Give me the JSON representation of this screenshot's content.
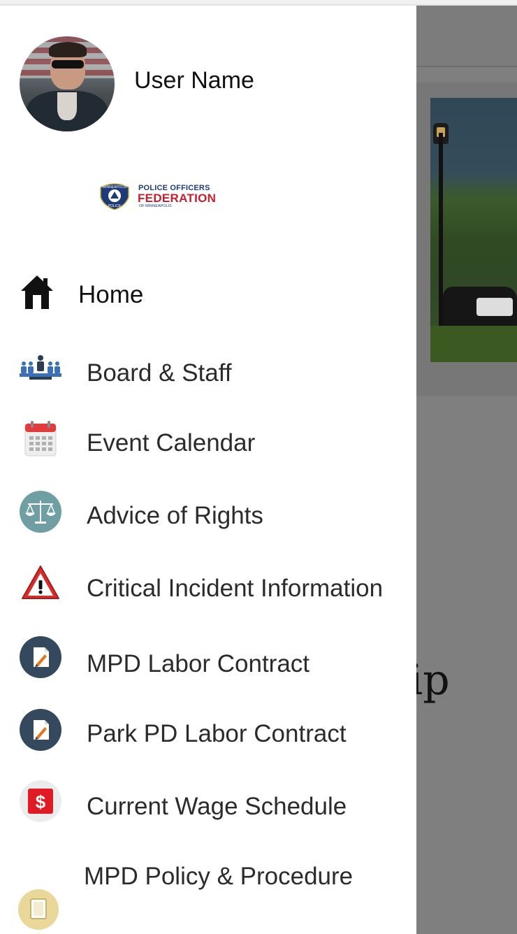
{
  "drawer": {
    "user_name": "User Name",
    "logo": {
      "line1": "POLICE OFFICERS",
      "line2": "FEDERATION",
      "line3": "OF MINNEAPOLIS",
      "badge_top": "MINNEAPOLIS",
      "badge_bottom": "POLICE"
    },
    "menu": [
      {
        "label": "Home",
        "icon": "home-icon"
      },
      {
        "label": "Board & Staff",
        "icon": "board-staff-icon"
      },
      {
        "label": "Event Calendar",
        "icon": "calendar-icon"
      },
      {
        "label": "Advice of Rights",
        "icon": "scales-icon"
      },
      {
        "label": "Critical Incident Information",
        "icon": "warning-icon"
      },
      {
        "label": "MPD Labor Contract",
        "icon": "document-pen-icon"
      },
      {
        "label": "Park PD Labor Contract",
        "icon": "document-pen-icon"
      },
      {
        "label": "Current Wage Schedule",
        "icon": "dollar-icon"
      },
      {
        "label": "MPD Policy & Procedure",
        "icon": "book-icon"
      }
    ]
  },
  "background": {
    "partial_text": "ip"
  },
  "colors": {
    "overlay": "#7f7f7f",
    "logo_blue": "#1d3b78",
    "logo_red": "#c41e2f",
    "icon_dark_circle": "#34495e",
    "icon_teal_circle": "#6f9ea3",
    "warning_red": "#d62d2d",
    "dollar_red": "#e01b24"
  }
}
